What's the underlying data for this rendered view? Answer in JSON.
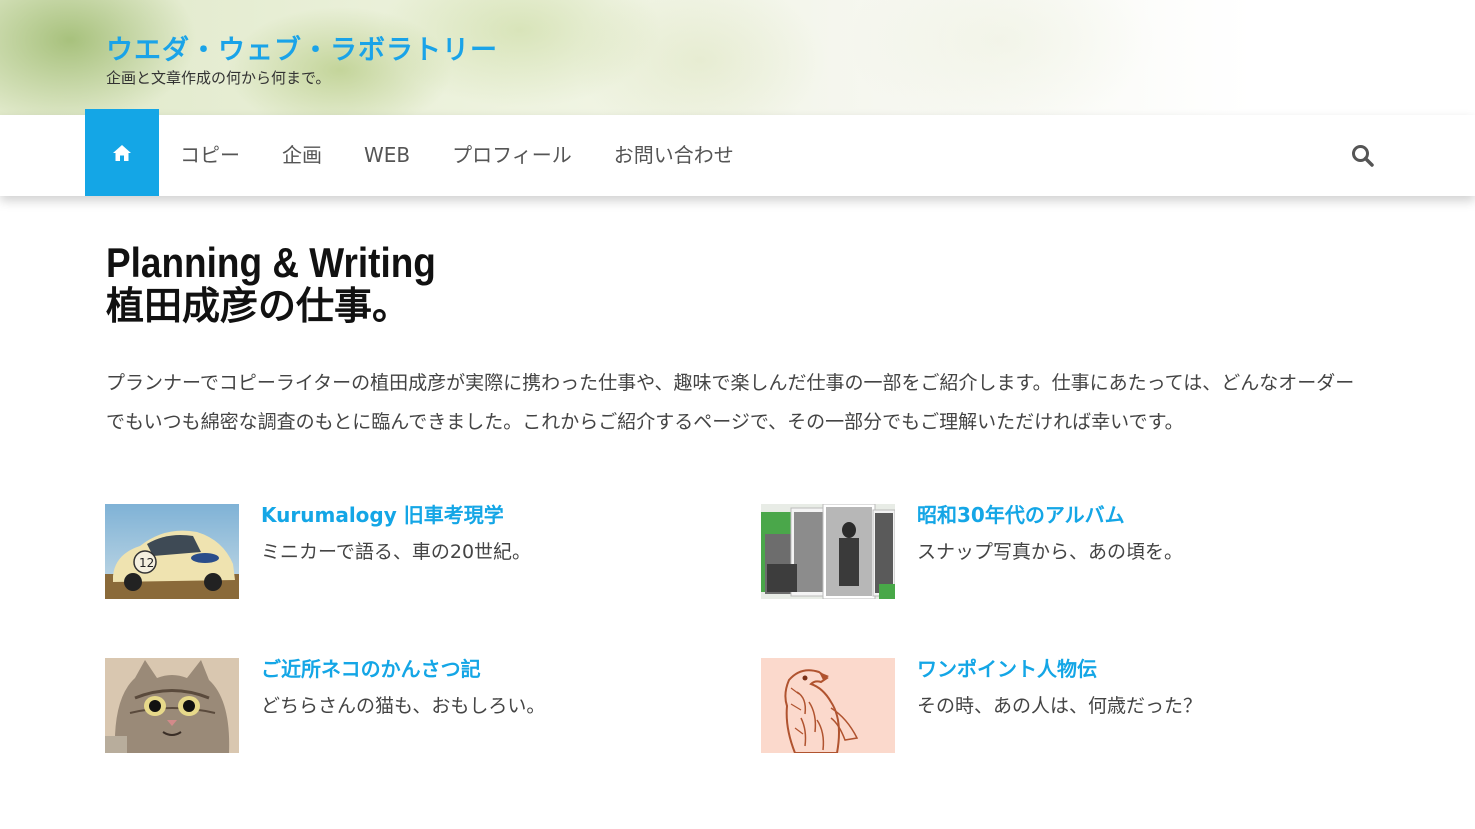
{
  "header": {
    "site_title": "ウエダ・ウェブ・ラボラトリー",
    "tagline": "企画と文章作成の何から何まで。"
  },
  "nav": {
    "home_icon": "home-icon",
    "items": [
      {
        "label": "コピー"
      },
      {
        "label": "企画"
      },
      {
        "label": "WEB"
      },
      {
        "label": "プロフィール"
      },
      {
        "label": "お問い合わせ"
      }
    ],
    "search_icon": "search-icon"
  },
  "main": {
    "headline_en": "Planning & Writing",
    "headline_ja": "植田成彦の仕事。",
    "intro": "プランナーでコピーライターの植田成彦が実際に携わった仕事や、趣味で楽しんだ仕事の一部をご紹介します。仕事にあたっては、どんなオーダーでもいつも綿密な調査のもとに臨んできました。これからご紹介するページで、その一部分でもご理解いただければ幸いです。",
    "cards": [
      {
        "title": "Kurumalogy 旧車考現学",
        "description": "ミニカーで語る、車の20世紀。",
        "thumb": "toy-car-photo"
      },
      {
        "title": "昭和30年代のアルバム",
        "description": "スナップ写真から、あの頃を。",
        "thumb": "old-photos-collage"
      },
      {
        "title": "ご近所ネコのかんさつ記",
        "description": "どちらさんの猫も、おもしろい。",
        "thumb": "tabby-cat-photo"
      },
      {
        "title": "ワンポイント人物伝",
        "description": "その時、あの人は、何歳だった？",
        "thumb": "hawk-illustration"
      }
    ]
  },
  "colors": {
    "accent": "#14a6e6",
    "text": "#444444",
    "heading": "#111111"
  }
}
